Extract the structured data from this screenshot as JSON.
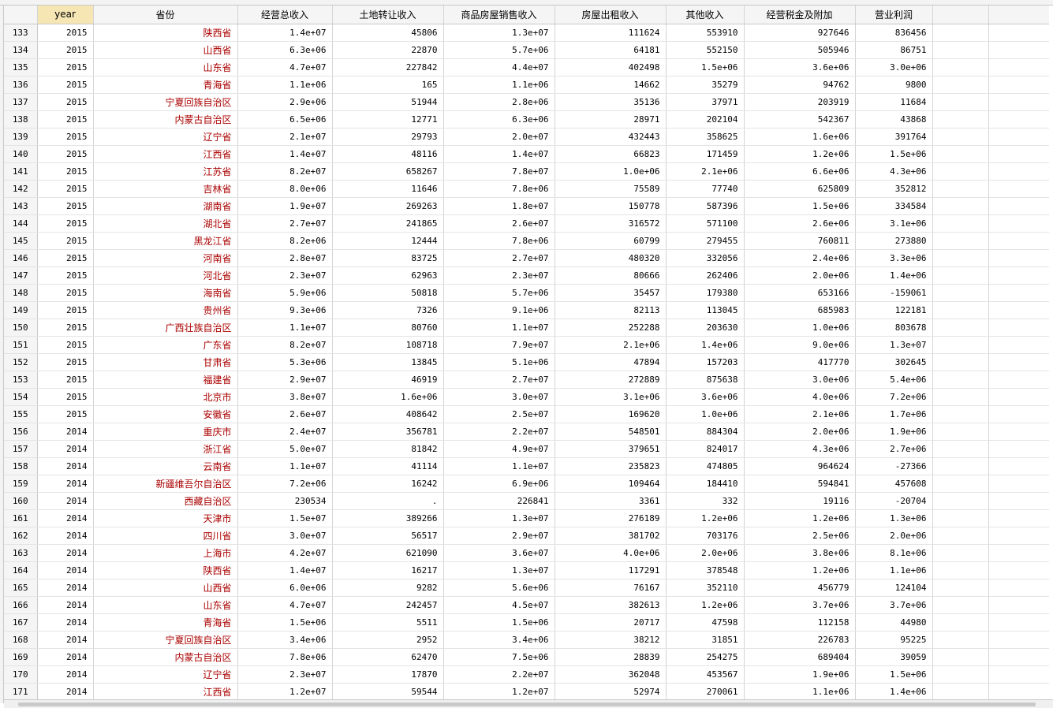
{
  "columns": [
    "year",
    "省份",
    "经营总收入",
    "土地转让收入",
    "商品房屋销售收入",
    "房屋出租收入",
    "其他收入",
    "经营税金及附加",
    "营业利润"
  ],
  "selected_column": "year",
  "rows": [
    [
      "133",
      "2015",
      "陕西省",
      "1.4e+07",
      "45806",
      "1.3e+07",
      "111624",
      "553910",
      "927646",
      "836456"
    ],
    [
      "134",
      "2015",
      "山西省",
      "6.3e+06",
      "22870",
      "5.7e+06",
      "64181",
      "552150",
      "505946",
      "86751"
    ],
    [
      "135",
      "2015",
      "山东省",
      "4.7e+07",
      "227842",
      "4.4e+07",
      "402498",
      "1.5e+06",
      "3.6e+06",
      "3.0e+06"
    ],
    [
      "136",
      "2015",
      "青海省",
      "1.1e+06",
      "165",
      "1.1e+06",
      "14662",
      "35279",
      "94762",
      "9800"
    ],
    [
      "137",
      "2015",
      "宁夏回族自治区",
      "2.9e+06",
      "51944",
      "2.8e+06",
      "35136",
      "37971",
      "203919",
      "11684"
    ],
    [
      "138",
      "2015",
      "内蒙古自治区",
      "6.5e+06",
      "12771",
      "6.3e+06",
      "28971",
      "202104",
      "542367",
      "43868"
    ],
    [
      "139",
      "2015",
      "辽宁省",
      "2.1e+07",
      "29793",
      "2.0e+07",
      "432443",
      "358625",
      "1.6e+06",
      "391764"
    ],
    [
      "140",
      "2015",
      "江西省",
      "1.4e+07",
      "48116",
      "1.4e+07",
      "66823",
      "171459",
      "1.2e+06",
      "1.5e+06"
    ],
    [
      "141",
      "2015",
      "江苏省",
      "8.2e+07",
      "658267",
      "7.8e+07",
      "1.0e+06",
      "2.1e+06",
      "6.6e+06",
      "4.3e+06"
    ],
    [
      "142",
      "2015",
      "吉林省",
      "8.0e+06",
      "11646",
      "7.8e+06",
      "75589",
      "77740",
      "625809",
      "352812"
    ],
    [
      "143",
      "2015",
      "湖南省",
      "1.9e+07",
      "269263",
      "1.8e+07",
      "150778",
      "587396",
      "1.5e+06",
      "334584"
    ],
    [
      "144",
      "2015",
      "湖北省",
      "2.7e+07",
      "241865",
      "2.6e+07",
      "316572",
      "571100",
      "2.6e+06",
      "3.1e+06"
    ],
    [
      "145",
      "2015",
      "黑龙江省",
      "8.2e+06",
      "12444",
      "7.8e+06",
      "60799",
      "279455",
      "760811",
      "273880"
    ],
    [
      "146",
      "2015",
      "河南省",
      "2.8e+07",
      "83725",
      "2.7e+07",
      "480320",
      "332056",
      "2.4e+06",
      "3.3e+06"
    ],
    [
      "147",
      "2015",
      "河北省",
      "2.3e+07",
      "62963",
      "2.3e+07",
      "80666",
      "262406",
      "2.0e+06",
      "1.4e+06"
    ],
    [
      "148",
      "2015",
      "海南省",
      "5.9e+06",
      "50818",
      "5.7e+06",
      "35457",
      "179380",
      "653166",
      "-159061"
    ],
    [
      "149",
      "2015",
      "贵州省",
      "9.3e+06",
      "7326",
      "9.1e+06",
      "82113",
      "113045",
      "685983",
      "122181"
    ],
    [
      "150",
      "2015",
      "广西壮族自治区",
      "1.1e+07",
      "80760",
      "1.1e+07",
      "252288",
      "203630",
      "1.0e+06",
      "803678"
    ],
    [
      "151",
      "2015",
      "广东省",
      "8.2e+07",
      "108718",
      "7.9e+07",
      "2.1e+06",
      "1.4e+06",
      "9.0e+06",
      "1.3e+07"
    ],
    [
      "152",
      "2015",
      "甘肃省",
      "5.3e+06",
      "13845",
      "5.1e+06",
      "47894",
      "157203",
      "417770",
      "302645"
    ],
    [
      "153",
      "2015",
      "福建省",
      "2.9e+07",
      "46919",
      "2.7e+07",
      "272889",
      "875638",
      "3.0e+06",
      "5.4e+06"
    ],
    [
      "154",
      "2015",
      "北京市",
      "3.8e+07",
      "1.6e+06",
      "3.0e+07",
      "3.1e+06",
      "3.6e+06",
      "4.0e+06",
      "7.2e+06"
    ],
    [
      "155",
      "2015",
      "安徽省",
      "2.6e+07",
      "408642",
      "2.5e+07",
      "169620",
      "1.0e+06",
      "2.1e+06",
      "1.7e+06"
    ],
    [
      "156",
      "2014",
      "重庆市",
      "2.4e+07",
      "356781",
      "2.2e+07",
      "548501",
      "884304",
      "2.0e+06",
      "1.9e+06"
    ],
    [
      "157",
      "2014",
      "浙江省",
      "5.0e+07",
      "81842",
      "4.9e+07",
      "379651",
      "824017",
      "4.3e+06",
      "2.7e+06"
    ],
    [
      "158",
      "2014",
      "云南省",
      "1.1e+07",
      "41114",
      "1.1e+07",
      "235823",
      "474805",
      "964624",
      "-27366"
    ],
    [
      "159",
      "2014",
      "新疆维吾尔自治区",
      "7.2e+06",
      "16242",
      "6.9e+06",
      "109464",
      "184410",
      "594841",
      "457608"
    ],
    [
      "160",
      "2014",
      "西藏自治区",
      "230534",
      ".",
      "226841",
      "3361",
      "332",
      "19116",
      "-20704"
    ],
    [
      "161",
      "2014",
      "天津市",
      "1.5e+07",
      "389266",
      "1.3e+07",
      "276189",
      "1.2e+06",
      "1.2e+06",
      "1.3e+06"
    ],
    [
      "162",
      "2014",
      "四川省",
      "3.0e+07",
      "56517",
      "2.9e+07",
      "381702",
      "703176",
      "2.5e+06",
      "2.0e+06"
    ],
    [
      "163",
      "2014",
      "上海市",
      "4.2e+07",
      "621090",
      "3.6e+07",
      "4.0e+06",
      "2.0e+06",
      "3.8e+06",
      "8.1e+06"
    ],
    [
      "164",
      "2014",
      "陕西省",
      "1.4e+07",
      "16217",
      "1.3e+07",
      "117291",
      "378548",
      "1.2e+06",
      "1.1e+06"
    ],
    [
      "165",
      "2014",
      "山西省",
      "6.0e+06",
      "9282",
      "5.6e+06",
      "76167",
      "352110",
      "456779",
      "124104"
    ],
    [
      "166",
      "2014",
      "山东省",
      "4.7e+07",
      "242457",
      "4.5e+07",
      "382613",
      "1.2e+06",
      "3.7e+06",
      "3.7e+06"
    ],
    [
      "167",
      "2014",
      "青海省",
      "1.5e+06",
      "5511",
      "1.5e+06",
      "20717",
      "47598",
      "112158",
      "44980"
    ],
    [
      "168",
      "2014",
      "宁夏回族自治区",
      "3.4e+06",
      "2952",
      "3.4e+06",
      "38212",
      "31851",
      "226783",
      "95225"
    ],
    [
      "169",
      "2014",
      "内蒙古自治区",
      "7.8e+06",
      "62470",
      "7.5e+06",
      "28839",
      "254275",
      "689404",
      "39059"
    ],
    [
      "170",
      "2014",
      "辽宁省",
      "2.3e+07",
      "17870",
      "2.2e+07",
      "362048",
      "453567",
      "1.9e+06",
      "1.5e+06"
    ],
    [
      "171",
      "2014",
      "江西省",
      "1.2e+07",
      "59544",
      "1.2e+07",
      "52974",
      "270061",
      "1.1e+06",
      "1.4e+06"
    ]
  ]
}
